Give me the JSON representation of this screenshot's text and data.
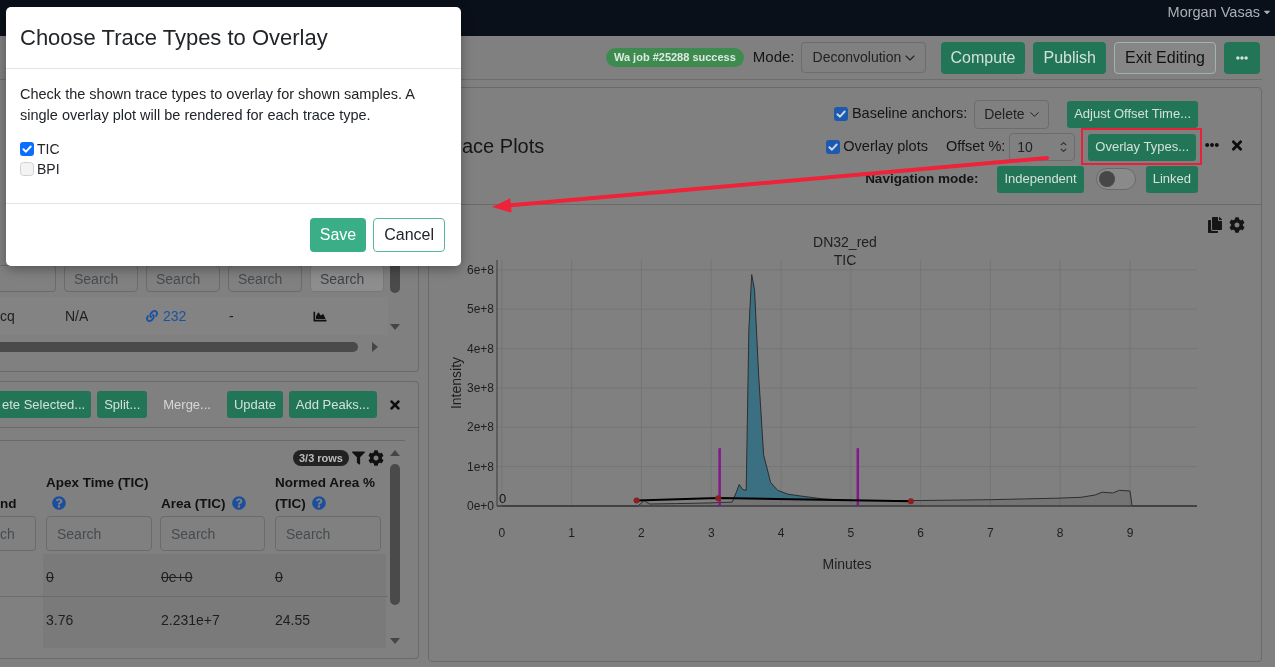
{
  "navbar": {
    "user": "Morgan Vasas"
  },
  "toolbar": {
    "job_badge": "Wa job #25288 success",
    "mode": {
      "label": "Mode:",
      "value": "Deconvolution"
    },
    "buttons": [
      {
        "label": "Compute",
        "kind": "primary"
      },
      {
        "label": "Publish",
        "kind": "primary"
      },
      {
        "label": "Exit Editing",
        "kind": "outline"
      },
      {
        "kind": "more"
      }
    ]
  },
  "samples_table": {
    "filters": [
      {
        "kind": "blank",
        "disabled": false
      },
      {
        "kind": "search",
        "placeholder": "Search",
        "disabled": false
      },
      {
        "kind": "search",
        "placeholder": "Search",
        "disabled": false
      },
      {
        "kind": "search",
        "placeholder": "Search",
        "disabled": false
      },
      {
        "kind": "search",
        "placeholder": "Search",
        "disabled": true
      }
    ],
    "rows": [
      {
        "cells": [
          {
            "kind": "text",
            "text": "cq"
          },
          {
            "kind": "text",
            "text": "N/A"
          },
          {
            "kind": "link",
            "text": "232"
          },
          {
            "kind": "text",
            "text": "-"
          },
          {
            "kind": "chart"
          }
        ]
      }
    ]
  },
  "peaks_panel": {
    "buttons": [
      {
        "label": "ete Selected...",
        "disabled": false
      },
      {
        "label": "Split...",
        "disabled": false
      },
      {
        "label": "Merge...",
        "disabled": true
      },
      {
        "label": "Update",
        "disabled": false
      },
      {
        "label": "Add Peaks...",
        "disabled": false
      }
    ],
    "row_count": "3/3 rows",
    "columns": [
      {
        "lines": [
          "nd"
        ],
        "help": false
      },
      {
        "lines": [
          "Apex Time (TIC)"
        ],
        "help": true
      },
      {
        "lines": [
          "Area (TIC)"
        ],
        "help": true
      },
      {
        "lines": [
          "Normed Area %",
          "(TIC)"
        ],
        "help": true
      }
    ],
    "filters": [
      {
        "placeholder": "ch"
      },
      {
        "placeholder": "Search"
      },
      {
        "placeholder": "Search"
      },
      {
        "placeholder": "Search"
      }
    ],
    "rows": [
      {
        "excluded": true,
        "cells": [
          "",
          "0",
          "0e+0",
          "0"
        ]
      },
      {
        "excluded": false,
        "cells": [
          "",
          "3.76",
          "2.231e+7",
          "24.55"
        ]
      }
    ]
  },
  "trace_panel": {
    "title": "ace Plots",
    "baseline_anchors": {
      "label": "Baseline anchors:",
      "checked": true,
      "value": "Delete"
    },
    "adjust_button": "Adjust Offset Time...",
    "overlay_plots": {
      "label": "Overlay plots",
      "checked": true
    },
    "offset": {
      "label": "Offset %:",
      "value": "10"
    },
    "overlay_types_button": "Overlay Types...",
    "navigation": {
      "label": "Navigation mode:",
      "options": [
        "Independent",
        "Linked"
      ],
      "on": false
    },
    "plot": {
      "chart_data": {
        "type": "area",
        "title": "DN32_red",
        "xlabel": "Minutes",
        "ylabel": "Intensity",
        "x": [
          0,
          1.93,
          1.95,
          2.0,
          2.04,
          2.07,
          2.12,
          2.5,
          3.0,
          3.1,
          3.12,
          3.3,
          3.36,
          3.4,
          3.45,
          3.5,
          3.54,
          3.58,
          3.62,
          3.68,
          3.75,
          3.85,
          3.95,
          4.1,
          4.3,
          4.6,
          5.0,
          5.1,
          5.86,
          6.0,
          7.0,
          7.5,
          8.0,
          8.3,
          8.5,
          8.6,
          8.75,
          8.85,
          9.0,
          9.03,
          9.96
        ],
        "series": [
          {
            "name": "TIC",
            "color": "#2e2e2e",
            "values": [
              0,
              0,
              0,
              8000000.0,
              15000000.0,
              10000000.0,
              5000000.0,
              6000000.0,
              8000000.0,
              9000000.0,
              9000000.0,
              10000000.0,
              35000000.0,
              55000000.0,
              42000000.0,
              40000000.0,
              450000000.0,
              588000000.0,
              550000000.0,
              330000000.0,
              130000000.0,
              60000000.0,
              40000000.0,
              30000000.0,
              25000000.0,
              18000000.0,
              14000000.0,
              14000000.0,
              14000000.0,
              14000000.0,
              16000000.0,
              18000000.0,
              20000000.0,
              22000000.0,
              28000000.0,
              35000000.0,
              33000000.0,
              40000000.0,
              38000000.0,
              0,
              0
            ]
          },
          {
            "color": "#3b6f82",
            "values": [
              null,
              null,
              null,
              null,
              null,
              null,
              null,
              null,
              null,
              null,
              20000000.0,
              19000000.0,
              35000000.0,
              55000000.0,
              42000000.0,
              40000000.0,
              450000000.0,
              588000000.0,
              550000000.0,
              330000000.0,
              130000000.0,
              60000000.0,
              40000000.0,
              30000000.0,
              25000000.0,
              18000000.0,
              14000000.0,
              14000000.0,
              null,
              null,
              null,
              null,
              null,
              null,
              null,
              null,
              null,
              null,
              null,
              null,
              null
            ]
          },
          {
            "type": "line",
            "marker": true,
            "color": "#000000",
            "values": [
              null,
              14000000.0,
              null,
              null,
              null,
              null,
              null,
              null,
              null,
              20000000.0,
              null,
              null,
              null,
              null,
              null,
              null,
              null,
              null,
              null,
              null,
              null,
              null,
              null,
              null,
              null,
              null,
              null,
              null,
              12000000.0,
              null,
              null,
              null,
              null,
              null,
              null,
              null,
              null,
              null,
              null,
              null,
              null
            ]
          }
        ],
        "xlim": [
          -0.07,
          9.96
        ],
        "ylim": [
          0,
          625000000.0
        ],
        "xticks": [
          0,
          1,
          2,
          3,
          4,
          5,
          6,
          7,
          8,
          9
        ],
        "yticks": [
          {
            "value": 0,
            "label": "0e+0"
          },
          {
            "value": 100000000.0,
            "label": "1e+8"
          },
          {
            "value": 200000000.0,
            "label": "2e+8"
          },
          {
            "value": 300000000.0,
            "label": "3e+8"
          },
          {
            "value": 400000000.0,
            "label": "4e+8"
          },
          {
            "value": 500000000.0,
            "label": "5e+8"
          },
          {
            "value": 600000000.0,
            "label": "6e+8"
          }
        ],
        "grid": true,
        "annotations": [
          "0"
        ]
      }
    }
  },
  "modal": {
    "title": "Choose Trace Types to Overlay",
    "text": "Check the shown trace types to overlay for shown samples. A single overlay plot will be rendered for each trace type.",
    "options": [
      {
        "label": "TIC",
        "checked": true
      },
      {
        "label": "BPI",
        "checked": false
      }
    ],
    "buttons": [
      {
        "label": "Save",
        "kind": "primary"
      },
      {
        "label": "Cancel",
        "kind": "secondary"
      }
    ]
  }
}
